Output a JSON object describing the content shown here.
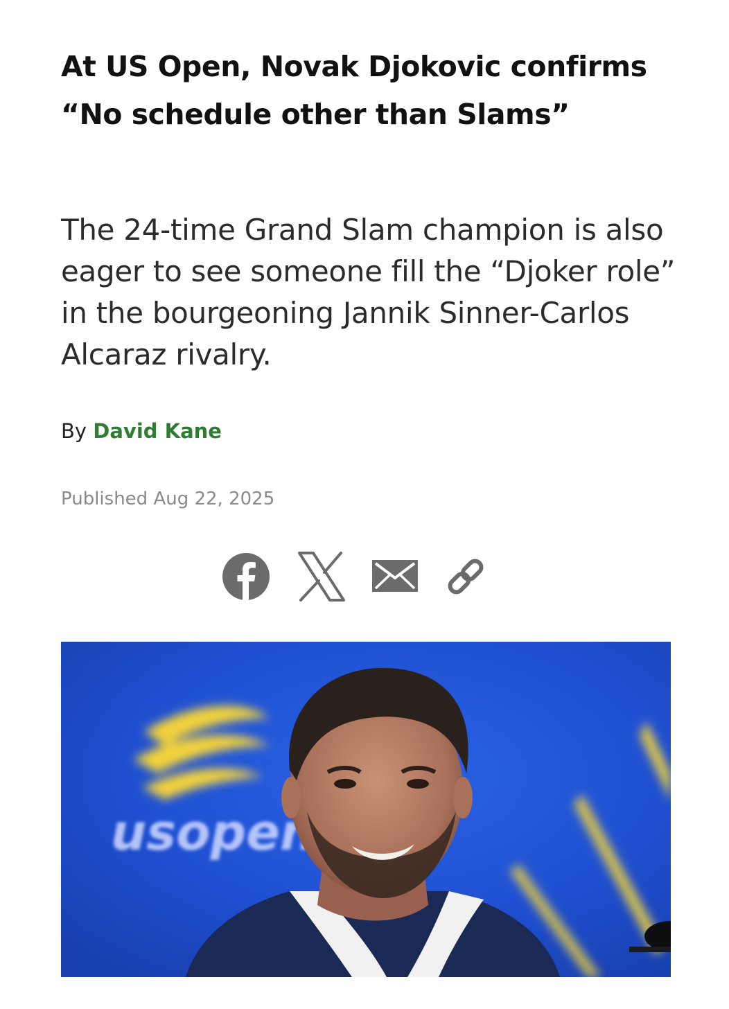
{
  "article": {
    "headline": "At US Open, Novak Djokovic confirms “No schedule other than Slams”",
    "dek": "The 24-time Grand Slam champion is also eager to see someone fill the “Djoker role” in the bourgeoning Jannik Sinner-Carlos Alcaraz rivalry.",
    "byline_prefix": "By",
    "author": "David Kane",
    "published": "Published Aug 22, 2025"
  },
  "share": {
    "icons": [
      "facebook-icon",
      "x-icon",
      "email-icon",
      "link-icon"
    ],
    "icon_color": "#6b6b6b"
  },
  "photo": {
    "logo_text": "usopen",
    "background_color": "#1f4fd0",
    "accent_color": "#f2d23a"
  },
  "colors": {
    "author_link": "#2f7d32",
    "published_text": "#8a8a8a"
  }
}
